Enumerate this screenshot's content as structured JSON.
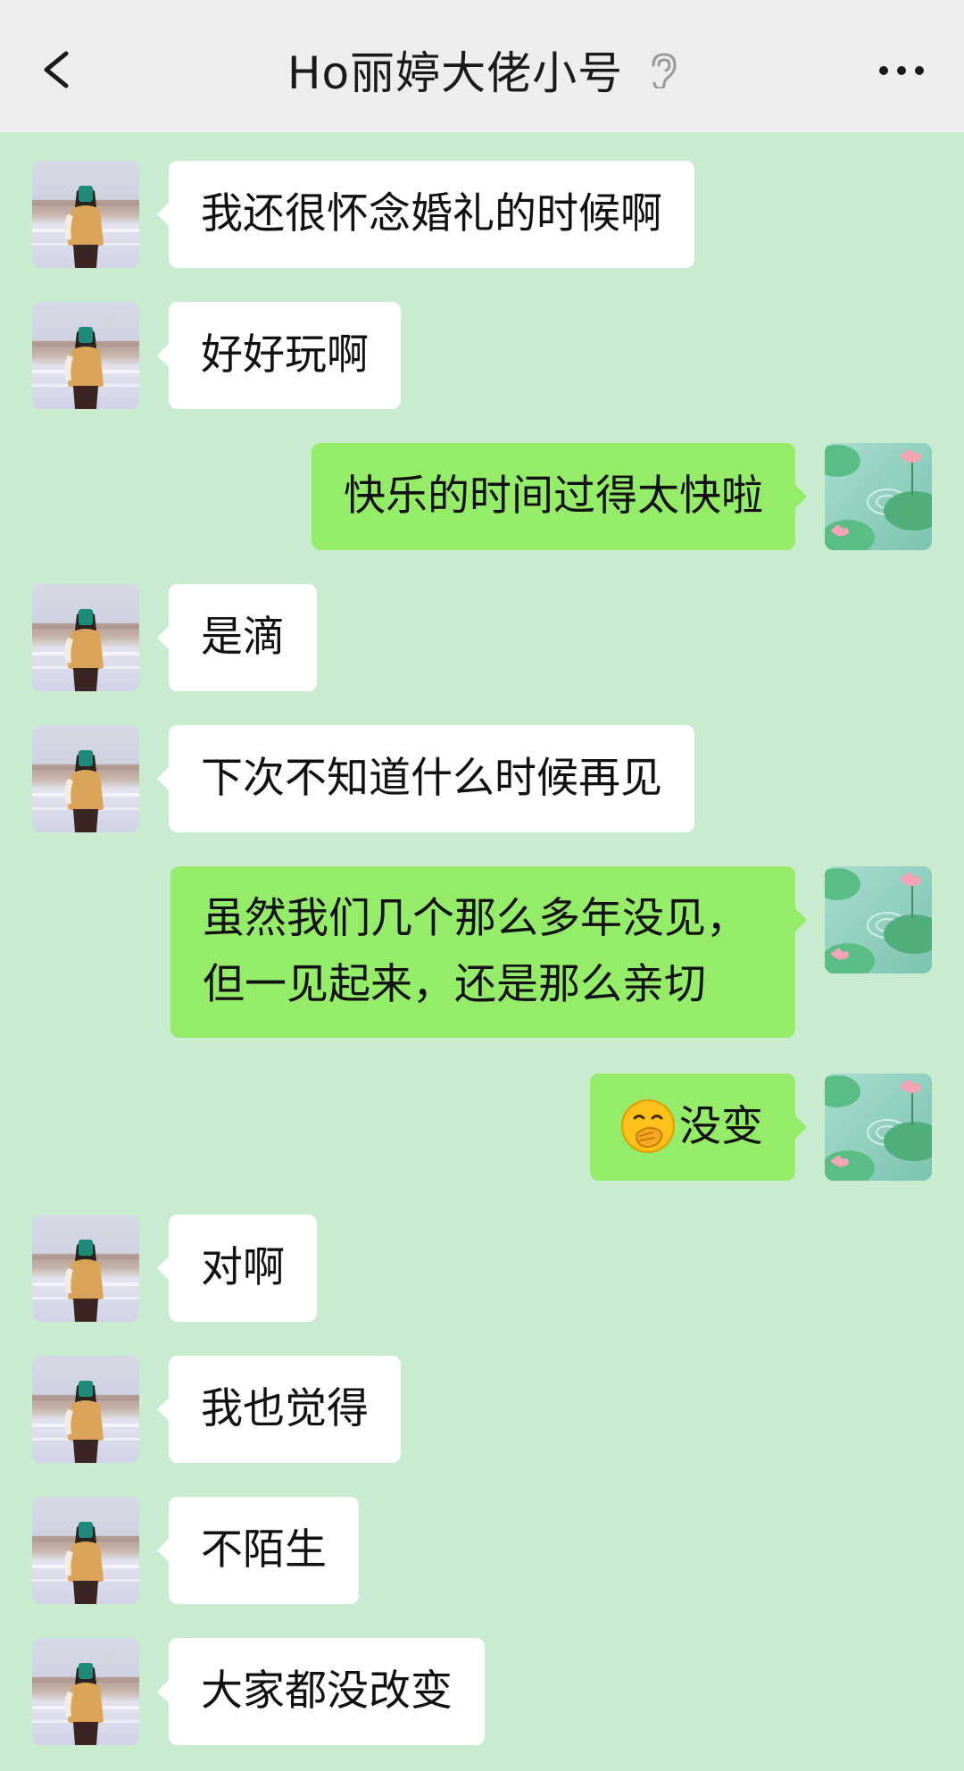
{
  "header": {
    "title": "Ho丽婷大佬小号",
    "back_icon": "chevron-left-icon",
    "status_icon": "ear-icon",
    "more_icon": "more-dots-icon"
  },
  "colors": {
    "chat_background": "#c9ecd1",
    "header_background": "#ededed",
    "incoming_bubble": "#ffffff",
    "outgoing_bubble": "#95ec69"
  },
  "messages": [
    {
      "side": "left",
      "text": "我还很怀念婚礼的时候啊"
    },
    {
      "side": "left",
      "text": "好好玩啊"
    },
    {
      "side": "right",
      "text": "快乐的时间过得太快啦"
    },
    {
      "side": "left",
      "text": "是滴"
    },
    {
      "side": "left",
      "text": "下次不知道什么时候再见"
    },
    {
      "side": "right",
      "lines": [
        "虽然我们几个那么多年没见，",
        "但一见起来，还是那么亲切"
      ]
    },
    {
      "side": "right",
      "emoji": "hand-over-mouth-emoji",
      "text": "没变"
    },
    {
      "side": "left",
      "text": "对啊"
    },
    {
      "side": "left",
      "text": "我也觉得"
    },
    {
      "side": "left",
      "text": "不陌生"
    },
    {
      "side": "left",
      "text": "大家都没改变"
    }
  ],
  "avatars": {
    "contact": "contact-avatar",
    "self": "self-avatar"
  }
}
